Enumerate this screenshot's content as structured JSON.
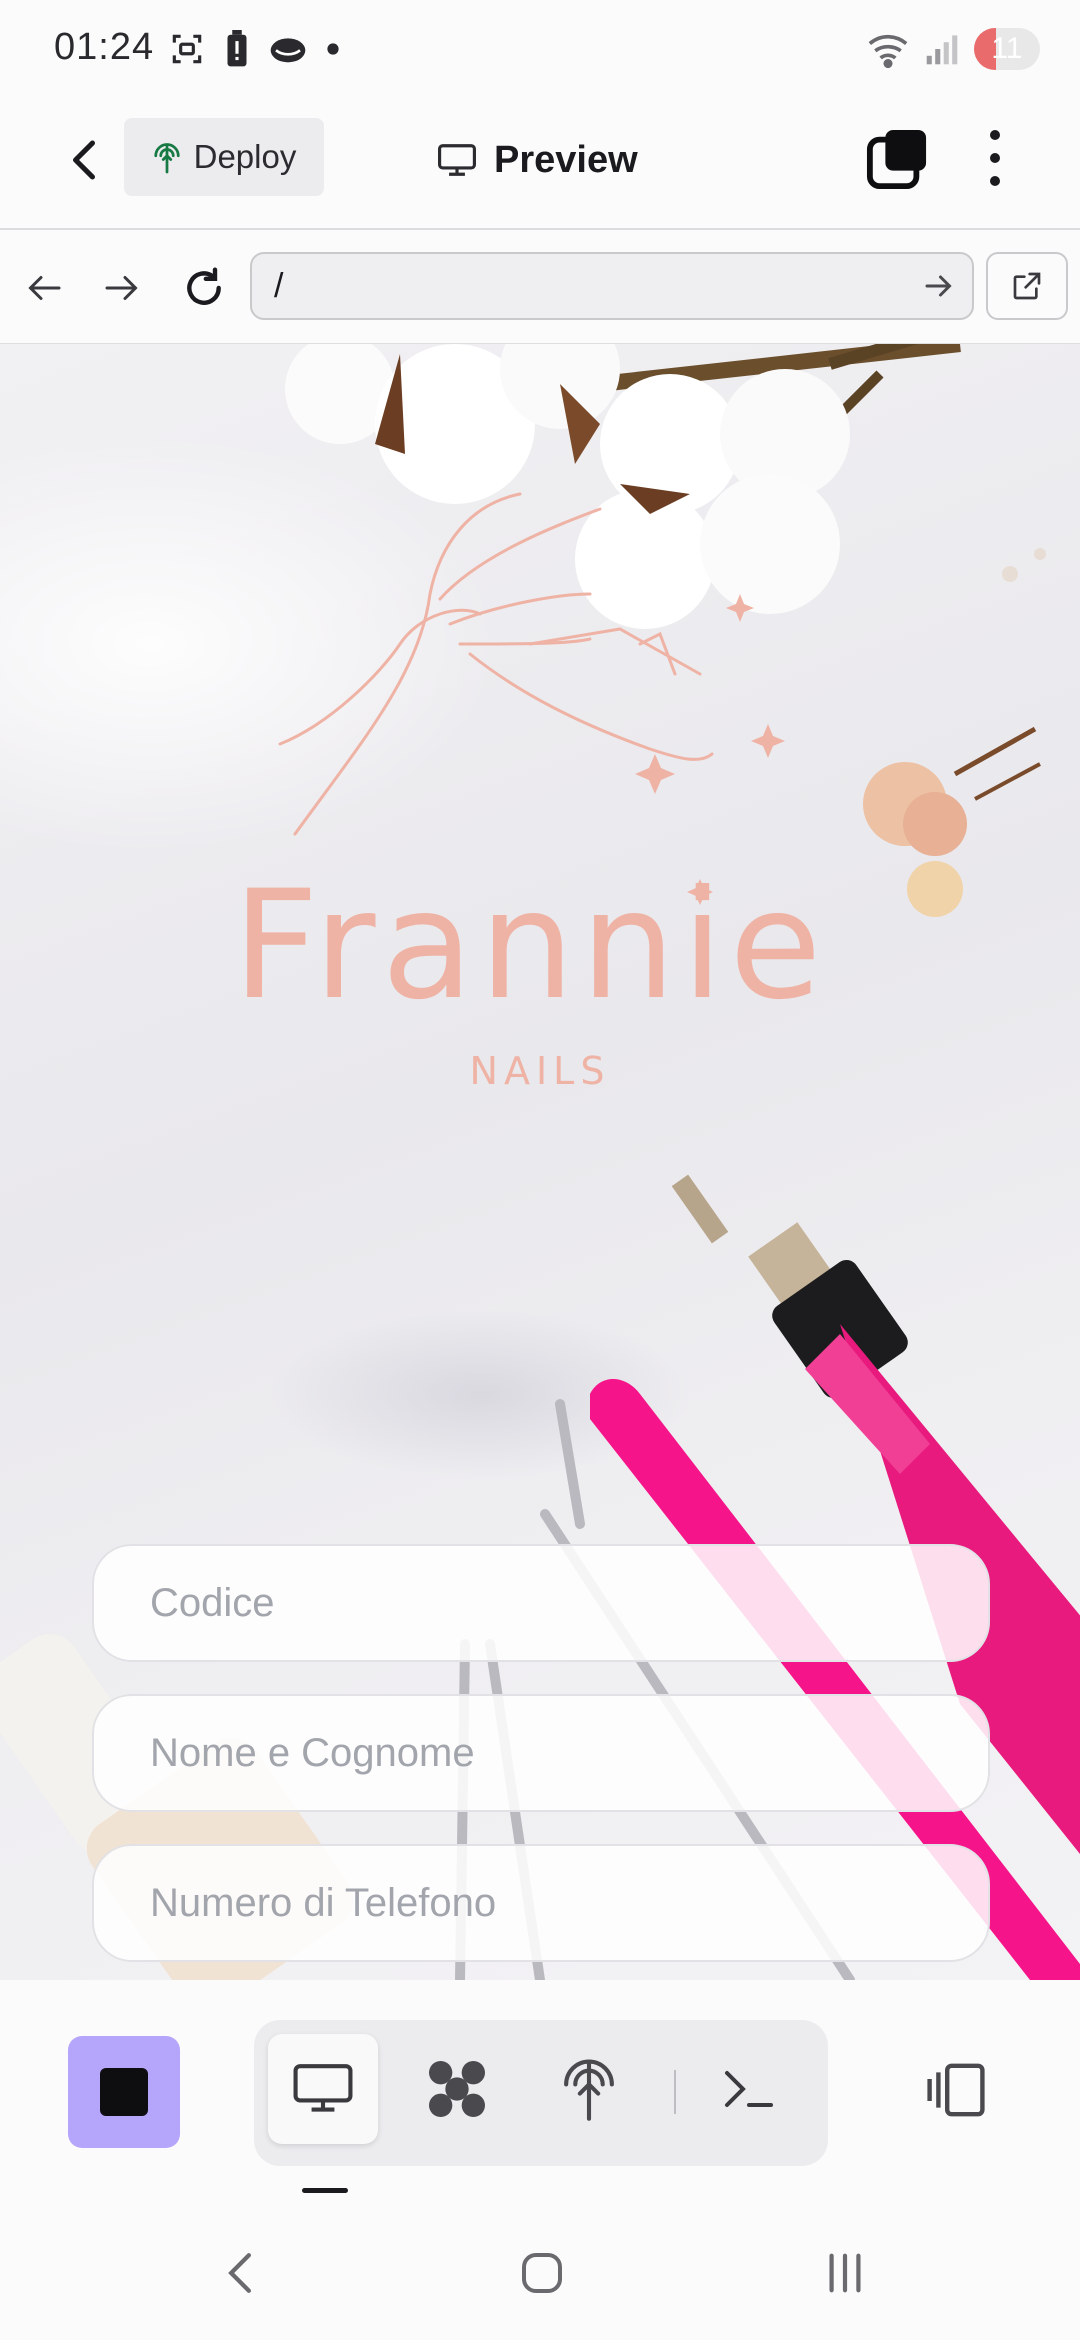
{
  "status_bar": {
    "time": "01:24",
    "battery_level": "11",
    "battery_fraction": 0.11,
    "icons_left": [
      "screenshot-icon",
      "battery-alert-icon",
      "cloud-icon",
      "dot-icon"
    ],
    "icons_right": [
      "wifi-icon",
      "signal-icon",
      "battery-icon"
    ]
  },
  "app_bar": {
    "deploy_label": "Deploy",
    "title": "Preview",
    "icons": [
      "back-arrow-icon",
      "deploy-icon",
      "monitor-icon",
      "tabs-icon",
      "more-vertical-icon"
    ]
  },
  "url_bar": {
    "value": "/",
    "icons": [
      "back-icon",
      "forward-icon",
      "reload-icon",
      "go-arrow-icon",
      "open-external-icon"
    ]
  },
  "preview": {
    "brand_title": "Frannie",
    "brand_subtitle": "NAILS",
    "fields": {
      "code_placeholder": "Codice",
      "name_placeholder": "Nome e Cognome",
      "phone_placeholder": "Numero di Telefono"
    },
    "colors": {
      "brand": "#efb3a5",
      "nail_file": "#f5148a",
      "drill": "#e81a7d"
    }
  },
  "toolbar": {
    "stop_color": "#b6a6fb",
    "segments": [
      "monitor-icon",
      "workspace-icon",
      "deploy-icon",
      "terminal-icon"
    ],
    "active_segment": "monitor-icon",
    "right_icon": "devices-icon"
  },
  "system_nav": [
    "nav-back-icon",
    "nav-home-icon",
    "nav-recents-icon"
  ]
}
